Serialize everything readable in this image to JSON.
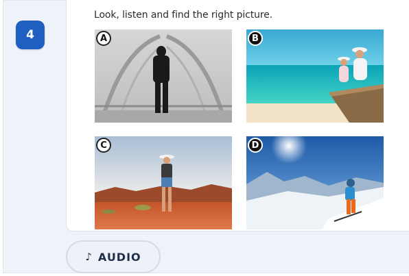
{
  "question": {
    "number": "4",
    "instruction": "Look, listen and find the right picture."
  },
  "options": [
    {
      "label": "A",
      "scene": "person-walking-foggy-bridge"
    },
    {
      "label": "B",
      "scene": "mother-and-child-on-beach-boat"
    },
    {
      "label": "C",
      "scene": "hiker-in-red-desert"
    },
    {
      "label": "D",
      "scene": "skier-on-snowy-mountain"
    }
  ],
  "audio": {
    "icon": "music-note-icon",
    "label": "AUDIO"
  },
  "colors": {
    "badge": "#1f5fbf",
    "panel": "#eef3fa",
    "card": "#ffffff"
  }
}
